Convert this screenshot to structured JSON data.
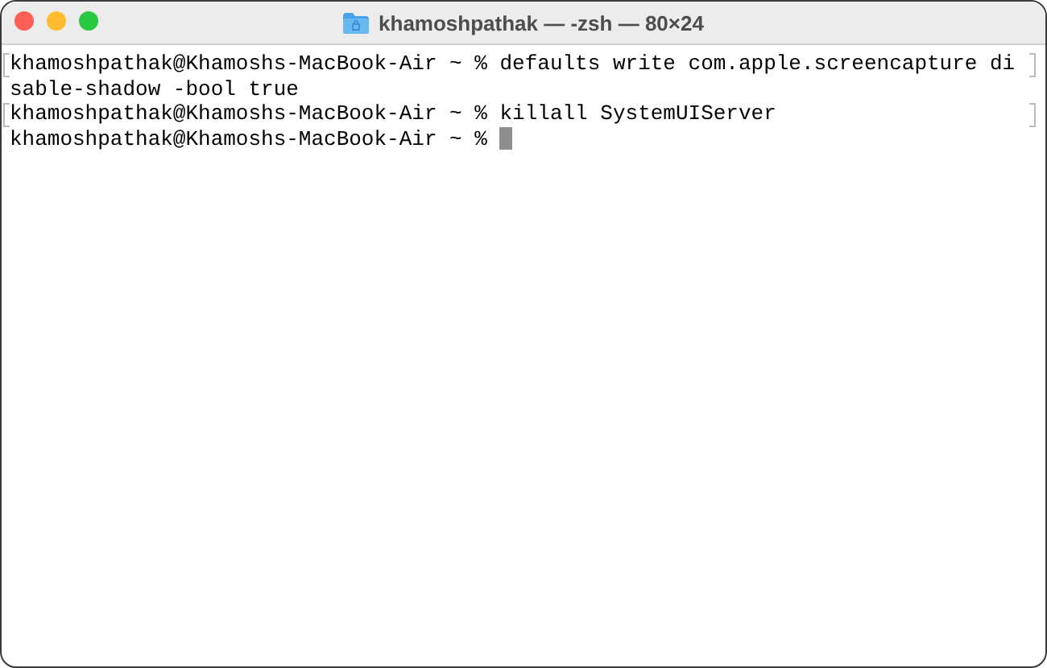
{
  "window": {
    "title": "khamoshpathak — -zsh — 80×24"
  },
  "terminal": {
    "lines": [
      {
        "text": "khamoshpathak@Khamoshs-MacBook-Air ~ % defaults write com.apple.screencapture di",
        "marked": true,
        "cursor": false
      },
      {
        "text": "sable-shadow -bool true",
        "marked": false,
        "cursor": false
      },
      {
        "text": "khamoshpathak@Khamoshs-MacBook-Air ~ % killall SystemUIServer",
        "marked": true,
        "cursor": false
      },
      {
        "text": "khamoshpathak@Khamoshs-MacBook-Air ~ % ",
        "marked": false,
        "cursor": true
      }
    ]
  }
}
